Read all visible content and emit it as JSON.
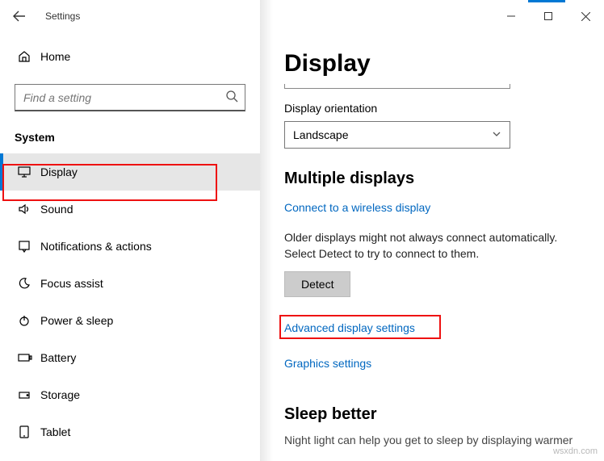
{
  "titlebar": {
    "title": "Settings"
  },
  "sidebar": {
    "home_label": "Home",
    "search_placeholder": "Find a setting",
    "category_label": "System",
    "items": [
      {
        "label": "Display",
        "icon": "monitor-icon",
        "active": true
      },
      {
        "label": "Sound",
        "icon": "speaker-icon",
        "active": false
      },
      {
        "label": "Notifications & actions",
        "icon": "notification-icon",
        "active": false
      },
      {
        "label": "Focus assist",
        "icon": "moon-icon",
        "active": false
      },
      {
        "label": "Power & sleep",
        "icon": "power-icon",
        "active": false
      },
      {
        "label": "Battery",
        "icon": "battery-icon",
        "active": false
      },
      {
        "label": "Storage",
        "icon": "storage-icon",
        "active": false
      },
      {
        "label": "Tablet",
        "icon": "tablet-icon",
        "active": false
      }
    ]
  },
  "main": {
    "heading": "Display",
    "orientation_label": "Display orientation",
    "orientation_value": "Landscape",
    "multi_heading": "Multiple displays",
    "connect_link": "Connect to a wireless display",
    "detect_help": "Older displays might not always connect automatically. Select Detect to try to connect to them.",
    "detect_button": "Detect",
    "advanced_link": "Advanced display settings",
    "graphics_link": "Graphics settings",
    "sleep_heading": "Sleep better",
    "sleep_text": "Night light can help you get to sleep by displaying warmer"
  },
  "watermark": "wsxdn.com"
}
